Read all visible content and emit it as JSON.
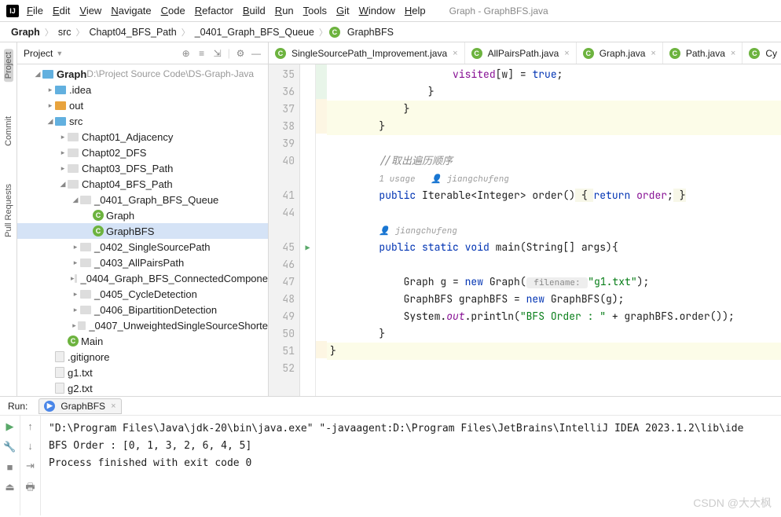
{
  "window": {
    "title": "Graph - GraphBFS.java"
  },
  "menu": [
    "File",
    "Edit",
    "View",
    "Navigate",
    "Code",
    "Refactor",
    "Build",
    "Run",
    "Tools",
    "Git",
    "Window",
    "Help"
  ],
  "breadcrumb": [
    "Graph",
    "src",
    "Chapt04_BFS_Path",
    "_0401_Graph_BFS_Queue",
    "GraphBFS"
  ],
  "left_tabs": [
    "Project",
    "Commit",
    "Pull Requests"
  ],
  "project": {
    "title": "Project",
    "root": {
      "name": "Graph",
      "path": "D:\\Project Source Code\\DS-Graph-Java"
    },
    "tree": [
      {
        "depth": 1,
        "arrow": "v",
        "icon": "folder",
        "label": "Graph",
        "bold": true,
        "dim": "D:\\Project Source Code\\DS-Graph-Java"
      },
      {
        "depth": 2,
        "arrow": ">",
        "icon": "folder",
        "label": ".idea"
      },
      {
        "depth": 2,
        "arrow": ">",
        "icon": "folder-orange",
        "label": "out"
      },
      {
        "depth": 2,
        "arrow": "v",
        "icon": "folder",
        "label": "src"
      },
      {
        "depth": 3,
        "arrow": ">",
        "icon": "pkg",
        "label": "Chapt01_Adjacency"
      },
      {
        "depth": 3,
        "arrow": ">",
        "icon": "pkg",
        "label": "Chapt02_DFS"
      },
      {
        "depth": 3,
        "arrow": ">",
        "icon": "pkg",
        "label": "Chapt03_DFS_Path"
      },
      {
        "depth": 3,
        "arrow": "v",
        "icon": "pkg",
        "label": "Chapt04_BFS_Path"
      },
      {
        "depth": 4,
        "arrow": "v",
        "icon": "pkg",
        "label": "_0401_Graph_BFS_Queue"
      },
      {
        "depth": 5,
        "arrow": "",
        "icon": "class",
        "label": "Graph"
      },
      {
        "depth": 5,
        "arrow": "",
        "icon": "class",
        "label": "GraphBFS",
        "selected": true
      },
      {
        "depth": 4,
        "arrow": ">",
        "icon": "pkg",
        "label": "_0402_SingleSourcePath"
      },
      {
        "depth": 4,
        "arrow": ">",
        "icon": "pkg",
        "label": "_0403_AllPairsPath"
      },
      {
        "depth": 4,
        "arrow": ">",
        "icon": "pkg",
        "label": "_0404_Graph_BFS_ConnectedCompone"
      },
      {
        "depth": 4,
        "arrow": ">",
        "icon": "pkg",
        "label": "_0405_CycleDetection"
      },
      {
        "depth": 4,
        "arrow": ">",
        "icon": "pkg",
        "label": "_0406_BipartitionDetection"
      },
      {
        "depth": 4,
        "arrow": ">",
        "icon": "pkg",
        "label": "_0407_UnweightedSingleSourceShorte"
      },
      {
        "depth": 3,
        "arrow": "",
        "icon": "class",
        "label": "Main"
      },
      {
        "depth": 2,
        "arrow": "",
        "icon": "file",
        "label": ".gitignore"
      },
      {
        "depth": 2,
        "arrow": "",
        "icon": "file",
        "label": "g1.txt"
      },
      {
        "depth": 2,
        "arrow": "",
        "icon": "file",
        "label": "g2.txt"
      }
    ]
  },
  "tabs": [
    {
      "label": "SingleSourcePath_Improvement.java"
    },
    {
      "label": "AllPairsPath.java"
    },
    {
      "label": "Graph.java"
    },
    {
      "label": "Path.java"
    },
    {
      "label": "Cy"
    }
  ],
  "editor": {
    "lines": [
      {
        "n": 35,
        "html": "                    <span class='field'>visited</span>[w] = <span class='kw'>true</span>;"
      },
      {
        "n": 36,
        "html": "                }"
      },
      {
        "n": 37,
        "html": "            }",
        "hl": "y"
      },
      {
        "n": 38,
        "html": "        }",
        "hl": "y"
      },
      {
        "n": 39,
        "html": ""
      },
      {
        "n": 40,
        "html": "        <span class='com'>//取出遍历顺序</span>"
      },
      {
        "ann": "1 usage   👤 jiangchufeng"
      },
      {
        "n": 41,
        "html": "        <span class='kw'>public</span> Iterable&lt;Integer&gt; order()<span class='bg-y'> { </span><span class='kw'>return</span> <span class='field'>order</span>;<span class='bg-y'> }</span>"
      },
      {
        "n": 44,
        "html": ""
      },
      {
        "ann": "👤 jiangchufeng"
      },
      {
        "n": 45,
        "html": "        <span class='kw'>public static void</span> main(String[] args){",
        "play": true
      },
      {
        "n": 46,
        "html": ""
      },
      {
        "n": 47,
        "html": "            Graph g = <span class='kw'>new</span> Graph(<span class='hint'> filename: </span><span class='str'>\"g1.txt\"</span>);"
      },
      {
        "n": 48,
        "html": "            GraphBFS graphBFS = <span class='kw'>new</span> GraphBFS(g);"
      },
      {
        "n": 49,
        "html": "            System.<span class='field'><i>out</i></span>.println(<span class='str'>\"BFS Order : \"</span> + graphBFS.order());"
      },
      {
        "n": 50,
        "html": "        }"
      },
      {
        "n": 51,
        "html": "<span class='bg-cursor'>}</span>",
        "hl": "y"
      },
      {
        "n": 52,
        "html": ""
      }
    ]
  },
  "run": {
    "title": "Run:",
    "tab": "GraphBFS",
    "lines": [
      "\"D:\\Program Files\\Java\\jdk-20\\bin\\java.exe\" \"-javaagent:D:\\Program Files\\JetBrains\\IntelliJ IDEA 2023.1.2\\lib\\ide",
      "BFS Order : [0, 1, 3, 2, 6, 4, 5]",
      "",
      "Process finished with exit code 0"
    ]
  },
  "watermark": "CSDN @大大枫"
}
